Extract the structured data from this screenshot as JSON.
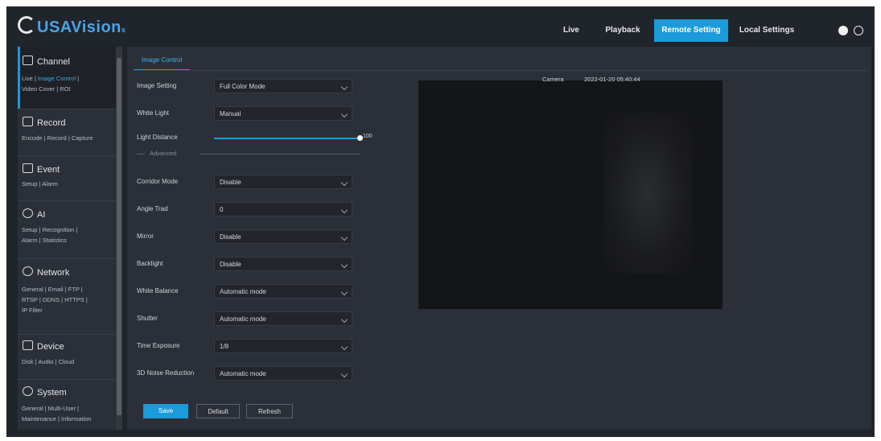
{
  "brand": {
    "logo_text": "USAVision",
    "logo_suffix": "s"
  },
  "nav": {
    "live": "Live",
    "playback": "Playback",
    "remote_setting": "Remote Setting",
    "local_settings": "Local Settings"
  },
  "sidebar": {
    "channel": {
      "title": "Channel",
      "links_line1_a": "Live",
      "links_line1_sep": "|",
      "links_line1_b": "Image Control",
      "links_line1_end": "|",
      "links_line2": "Video Cover  |  ROI"
    },
    "record": {
      "title": "Record",
      "links": "Encode  |  Record  |  Capture"
    },
    "event": {
      "title": "Event",
      "links": "Setup  |  Alarm"
    },
    "ai": {
      "title": "AI",
      "links_line1": "Setup  |  Recognition  |",
      "links_line2": "Alarm  |  Statistics"
    },
    "network": {
      "title": "Network",
      "links_line1": "General  |  Email  |  FTP  |",
      "links_line2": "RTSP  |  DDNS  |  HTTPS  |",
      "links_line3": "IP Filter"
    },
    "device": {
      "title": "Device",
      "links": "Disk  |  Audio  |  Cloud"
    },
    "system": {
      "title": "System",
      "links_line1": "General  |  Multi-User  |",
      "links_line2": "Maintenance  |  Information"
    }
  },
  "main": {
    "tab": "Image Control",
    "fields": {
      "image_setting": {
        "label": "Image Setting",
        "value": "Full Color Mode"
      },
      "white_light": {
        "label": "White Light",
        "value": "Manual"
      },
      "light_distance": {
        "label": "Light Distance",
        "value": "100"
      },
      "advanced": "Advanced",
      "corridor_mode": {
        "label": "Corridor Mode",
        "value": "Disable"
      },
      "angle_trad": {
        "label": "Angle Trad",
        "value": "0"
      },
      "mirror": {
        "label": "Mirror",
        "value": "Disable"
      },
      "backlight": {
        "label": "Backlight",
        "value": "Disable"
      },
      "white_balance": {
        "label": "White Balance",
        "value": "Automatic mode"
      },
      "shutter": {
        "label": "Shutter",
        "value": "Automatic mode"
      },
      "time_exposure": {
        "label": "Time Exposure",
        "value": "1/8"
      },
      "noise_reduction": {
        "label": "3D Noise Reduction",
        "value": "Automatic mode"
      }
    },
    "buttons": {
      "save": "Save",
      "default": "Default",
      "refresh": "Refresh"
    },
    "preview": {
      "camera_label": "Camera",
      "timestamp": "2022-01-20 05:40:44"
    }
  },
  "colors": {
    "accent": "#1b9bd9",
    "background": "#20242b",
    "panel": "#2b3038"
  }
}
